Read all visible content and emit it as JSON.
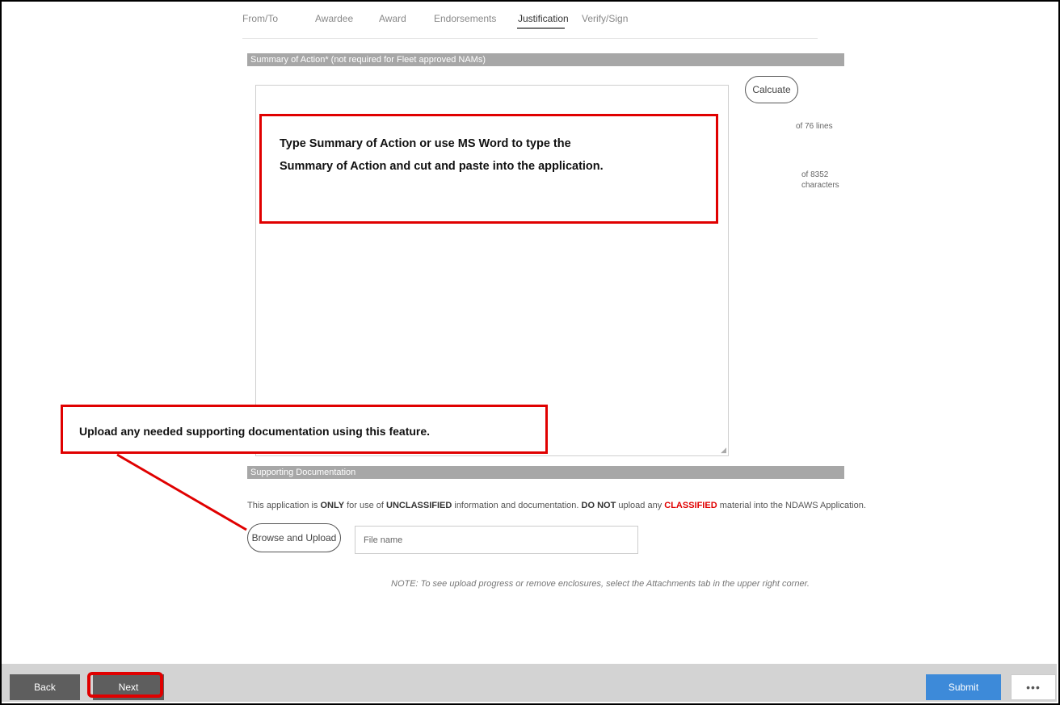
{
  "tabs": [
    {
      "label": "From/To"
    },
    {
      "label": "Awardee"
    },
    {
      "label": "Award"
    },
    {
      "label": "Endorsements"
    },
    {
      "label": "Justification"
    },
    {
      "label": "Verify/Sign"
    }
  ],
  "summary": {
    "header": "Summary of Action* (not required for Fleet approved NAMs)",
    "calculate_label": "Calcuate",
    "lines_text": "of 76 lines",
    "chars_text_1": "of 8352",
    "chars_text_2": "characters"
  },
  "callouts": {
    "summary_line1": "Type Summary of Action or use MS Word to type the",
    "summary_line2": "Summary of Action and cut and paste into the application.",
    "upload": "Upload any needed supporting documentation using this feature."
  },
  "supporting": {
    "header": "Supporting Documentation",
    "warning_1": "This application is ",
    "warning_only": "ONLY",
    "warning_2": " for use of ",
    "warning_unclassified": "UNCLASSIFIED",
    "warning_3": " information and documentation. ",
    "warning_donot": "DO NOT",
    "warning_4": " upload any ",
    "warning_classified": "CLASSIFIED",
    "warning_5": " material into the NDAWS Application.",
    "browse_label": "Browse and Upload",
    "file_placeholder": "File name",
    "note": "NOTE: To see upload progress or remove enclosures, select the Attachments tab in the upper right corner."
  },
  "footer": {
    "back": "Back",
    "next": "Next",
    "submit": "Submit",
    "more": "•••"
  },
  "colors": {
    "callout_border": "#e00000",
    "submit_blue": "#3d8ad9",
    "section_gray": "#a7a7a7",
    "footer_gray": "#d3d3d3"
  }
}
